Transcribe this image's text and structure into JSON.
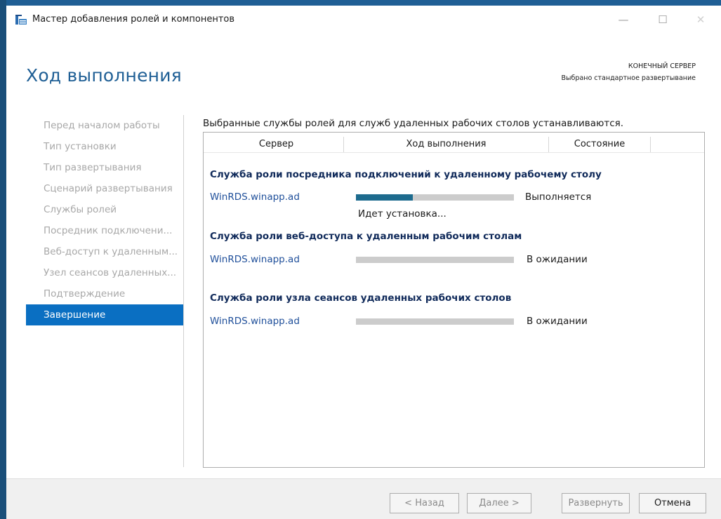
{
  "window": {
    "title": "Мастер добавления ролей и компонентов",
    "icon": "server-manager-icon",
    "controls": {
      "minimize": "—",
      "maximize": "☐",
      "close": "✕"
    }
  },
  "header": {
    "title": "Ход выполнения",
    "destination_label": "КОНЕЧНЫЙ СЕРВЕР",
    "destination_value": "Выбрано стандартное развертывание"
  },
  "sidebar": {
    "items": [
      {
        "label": "Перед началом работы",
        "active": false
      },
      {
        "label": "Тип установки",
        "active": false
      },
      {
        "label": "Тип развертывания",
        "active": false
      },
      {
        "label": "Сценарий развертывания",
        "active": false
      },
      {
        "label": "Службы ролей",
        "active": false
      },
      {
        "label": "Посредник подключени...",
        "active": false
      },
      {
        "label": "Веб-доступ к удаленным...",
        "active": false
      },
      {
        "label": "Узел сеансов удаленных...",
        "active": false
      },
      {
        "label": "Подтверждение",
        "active": false
      },
      {
        "label": "Завершение",
        "active": true
      }
    ]
  },
  "main": {
    "intro": "Выбранные службы ролей для служб удаленных рабочих столов устанавливаются.",
    "columns": {
      "server": "Сервер",
      "progress": "Ход выполнения",
      "state": "Состояние"
    },
    "groups": [
      {
        "title": "Служба роли посредника подключений к удаленному рабочему столу",
        "server": "WinRDS.winapp.ad",
        "progress": 0.36,
        "state": "Выполняется",
        "substatus": "Идет установка..."
      },
      {
        "title": "Служба роли веб-доступа к удаленным рабочим столам",
        "server": "WinRDS.winapp.ad",
        "progress": 0,
        "state": "В ожидании",
        "substatus": ""
      },
      {
        "title": "Служба роли узла сеансов удаленных рабочих столов",
        "server": "WinRDS.winapp.ad",
        "progress": 0,
        "state": "В ожидании",
        "substatus": ""
      }
    ]
  },
  "footer": {
    "back": "< Назад",
    "next": "Далее >",
    "deploy": "Развернуть",
    "cancel": "Отмена"
  },
  "colors": {
    "accent": "#1f5f95",
    "nav_active": "#0a6fc2",
    "progress_fill": "#1d6b8e",
    "progress_track": "#cccccc",
    "group_title": "#102a5a",
    "server_link": "#1f4f9a"
  }
}
